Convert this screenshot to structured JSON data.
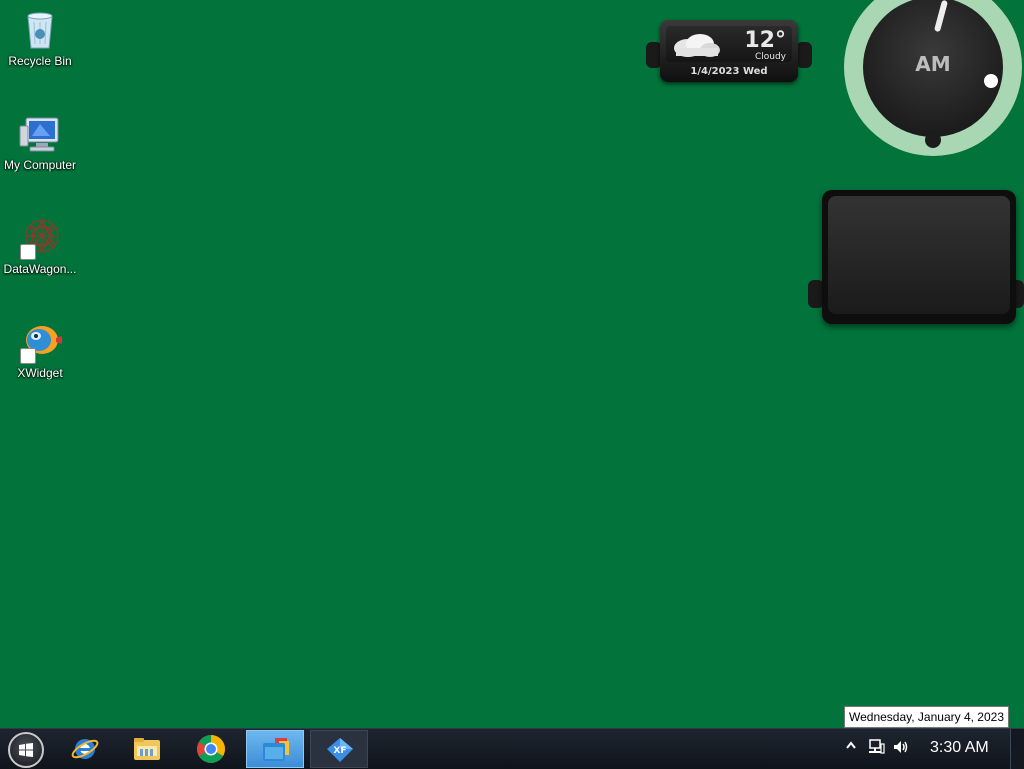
{
  "desktop_icons": [
    {
      "label": "Recycle Bin",
      "icon": "recycle-bin-icon"
    },
    {
      "label": "My Computer",
      "icon": "computer-icon"
    },
    {
      "label": "DataWagon...",
      "icon": "datawagon-icon"
    },
    {
      "label": "XWidget",
      "icon": "xwidget-icon"
    }
  ],
  "weather": {
    "temp": "12°",
    "condition": "Cloudy",
    "date": "1/4/2023 Wed"
  },
  "clock_widget": {
    "ampm": "AM"
  },
  "tooltip": "Wednesday, January 4, 2023",
  "taskbar": {
    "time": "3:30 AM",
    "apps": [
      "internet-explorer-icon",
      "file-explorer-icon",
      "chrome-icon",
      "xwidget-manager-icon",
      "xwidget-designer-icon"
    ]
  },
  "colors": {
    "desktop_bg": "#02733a"
  }
}
